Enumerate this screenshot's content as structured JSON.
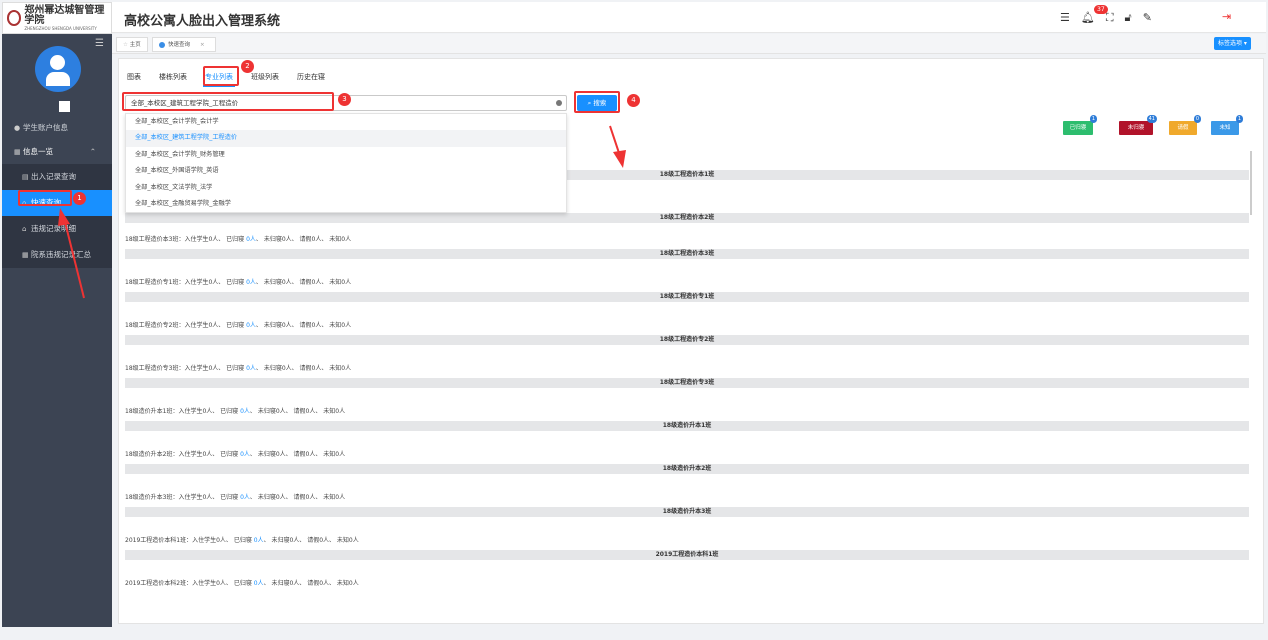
{
  "app": {
    "title": "高校公寓人脸出入管理系统",
    "logo_text": "郑州幂达城智管理学院",
    "logo_sub": "ZHENGZHOU SHENGDA UNIVERSITY",
    "notification_count": "37"
  },
  "sidebar": {
    "items": [
      {
        "label": "学生账户信息"
      },
      {
        "label": "信息一览"
      },
      {
        "label": "出入记录查询"
      },
      {
        "label": "快速查询"
      },
      {
        "label": "违规记录明细"
      },
      {
        "label": "院系违规记录汇总"
      }
    ]
  },
  "tabs": {
    "home": "主页",
    "quick": "快速查询",
    "close": "×",
    "tag_options": "标签选项 ▾"
  },
  "subtabs": [
    "图表",
    "楼栋列表",
    "专业列表",
    "班级列表",
    "历史在寝"
  ],
  "search": {
    "value": "全部_本校区_建筑工程学院_工程造价",
    "button": "搜索",
    "options": [
      "全部_本校区_会计学院_会计学",
      "全部_本校区_建筑工程学院_工程造价",
      "全部_本校区_会计学院_财务管理",
      "全部_本校区_外国语学院_英语",
      "全部_本校区_文法学院_法学",
      "全部_本校区_金融贸易学院_金融学"
    ]
  },
  "legend": [
    {
      "label": "已归寝",
      "count": "1",
      "color": "#2dbd6e"
    },
    {
      "label": "未归寝",
      "count": "41",
      "color": "#b1132a"
    },
    {
      "label": "请假",
      "count": "0",
      "color": "#f0a92c"
    },
    {
      "label": "未知",
      "count": "1",
      "color": "#3b99e8"
    }
  ],
  "records": [
    {
      "cls": "18级工程造价本3班",
      "bar": "18级工程造价本3班"
    },
    {
      "cls": "18级工程造价专1班",
      "bar": "18级工程造价专1班"
    },
    {
      "cls": "18级工程造价专2班",
      "bar": "18级工程造价专2班"
    },
    {
      "cls": "18级工程造价专3班",
      "bar": "18级工程造价专3班"
    },
    {
      "cls": "18级造价升本1班",
      "bar": "18级造价升本1班"
    },
    {
      "cls": "18级造价升本2班",
      "bar": "18级造价升本2班"
    },
    {
      "cls": "18级造价升本3班",
      "bar": "18级造价升本3班"
    },
    {
      "cls": "2019工程造价本科1班",
      "bar": "2019工程造价本科1班"
    },
    {
      "cls": "2019工程造价本科2班",
      "bar": ""
    }
  ],
  "record_parts": {
    "a": "：入住学生0人、 已归寝 ",
    "ok": "0人",
    "b": "、 未归寝0人、 请假0人、 未知0人"
  },
  "top_bars": [
    "18级工程造价本1班",
    "18级工程造价本2班"
  ],
  "annotations": [
    "1",
    "2",
    "3",
    "4"
  ]
}
